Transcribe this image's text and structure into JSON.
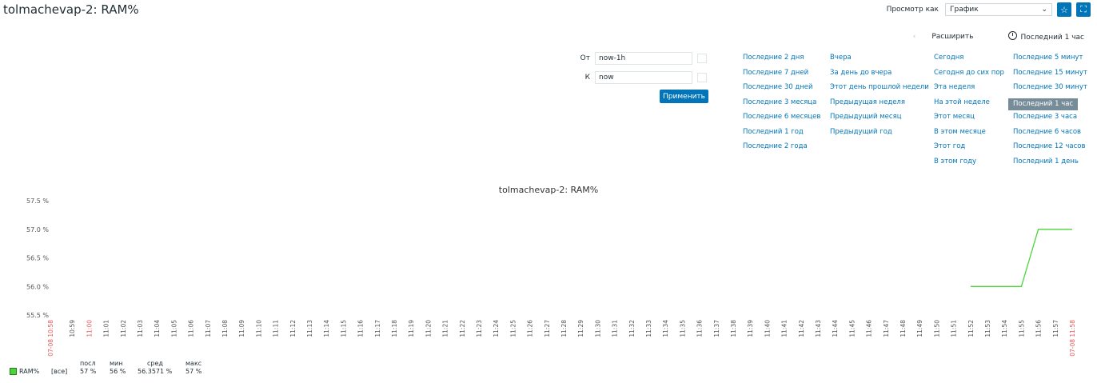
{
  "page": {
    "title": "tolmachevap-2: RAM%",
    "view_as_label": "Просмотр как",
    "view_as_value": "График",
    "expand_label": "Расширить",
    "period_label": "Последний 1 час",
    "favorite_icon": "star-icon",
    "fullscreen_icon": "fullscreen-icon"
  },
  "filter": {
    "from_label": "От",
    "from_value": "now-1h",
    "to_label": "К",
    "to_value": "now",
    "apply_label": "Применить"
  },
  "quick": {
    "col1": [
      "Последние 2 дня",
      "Последние 7 дней",
      "Последние 30 дней",
      "Последние 3 месяца",
      "Последние 6 месяцев",
      "Последний 1 год",
      "Последние 2 года"
    ],
    "col2": [
      "Вчера",
      "За день до вчера",
      "Этот день прошлой недели",
      "Предыдущая неделя",
      "Предыдущий месяц",
      "Предыдущий год"
    ],
    "col3": [
      "Сегодня",
      "Сегодня до сих пор",
      "Эта неделя",
      "На этой неделе",
      "Этот месяц",
      "В этом месяце",
      "Этот год",
      "В этом году"
    ],
    "col4": [
      "Последние 5 минут",
      "Последние 15 минут",
      "Последние 30 минут",
      "Последний 1 час",
      "Последние 3 часа",
      "Последние 6 часов",
      "Последние 12 часов",
      "Последний 1 день"
    ],
    "selected": "Последний 1 час"
  },
  "chart_data": {
    "type": "line",
    "title": "tolmachevap-2: RAM%",
    "xlabel": "",
    "ylabel": "",
    "y_ticks": [
      "57.5 %",
      "57.0 %",
      "56.5 %",
      "56.0 %",
      "55.5 %"
    ],
    "ylim": [
      55.5,
      57.5
    ],
    "x_start_label": "07-08 10:58",
    "x_end_label": "07-08 11:58",
    "x_ticks": [
      "10:59",
      "11:00",
      "11:01",
      "11:02",
      "11:03",
      "11:04",
      "11:05",
      "11:06",
      "11:07",
      "11:08",
      "11:09",
      "11:10",
      "11:11",
      "11:12",
      "11:13",
      "11:14",
      "11:15",
      "11:16",
      "11:17",
      "11:18",
      "11:19",
      "11:20",
      "11:21",
      "11:22",
      "11:23",
      "11:24",
      "11:25",
      "11:26",
      "11:27",
      "11:28",
      "11:29",
      "11:30",
      "11:31",
      "11:32",
      "11:33",
      "11:34",
      "11:35",
      "11:36",
      "11:37",
      "11:38",
      "11:39",
      "11:40",
      "11:41",
      "11:42",
      "11:43",
      "11:44",
      "11:45",
      "11:46",
      "11:47",
      "11:48",
      "11:49",
      "11:50",
      "11:51",
      "11:52",
      "11:53",
      "11:54",
      "11:55",
      "11:56",
      "11:57"
    ],
    "series": [
      {
        "name": "RAM%",
        "color": "#4ad43a",
        "x": [
          "11:52",
          "11:53",
          "11:54",
          "11:55",
          "11:55:30",
          "11:56",
          "11:57",
          "11:58"
        ],
        "y": [
          56,
          56,
          56,
          56,
          56.5,
          57,
          57,
          57
        ]
      }
    ],
    "legend": {
      "headers": [
        "посл",
        "мин",
        "сред",
        "макс"
      ],
      "item": "[все]",
      "values": [
        "57 %",
        "56 %",
        "56.3571 %",
        "57 %"
      ]
    }
  }
}
